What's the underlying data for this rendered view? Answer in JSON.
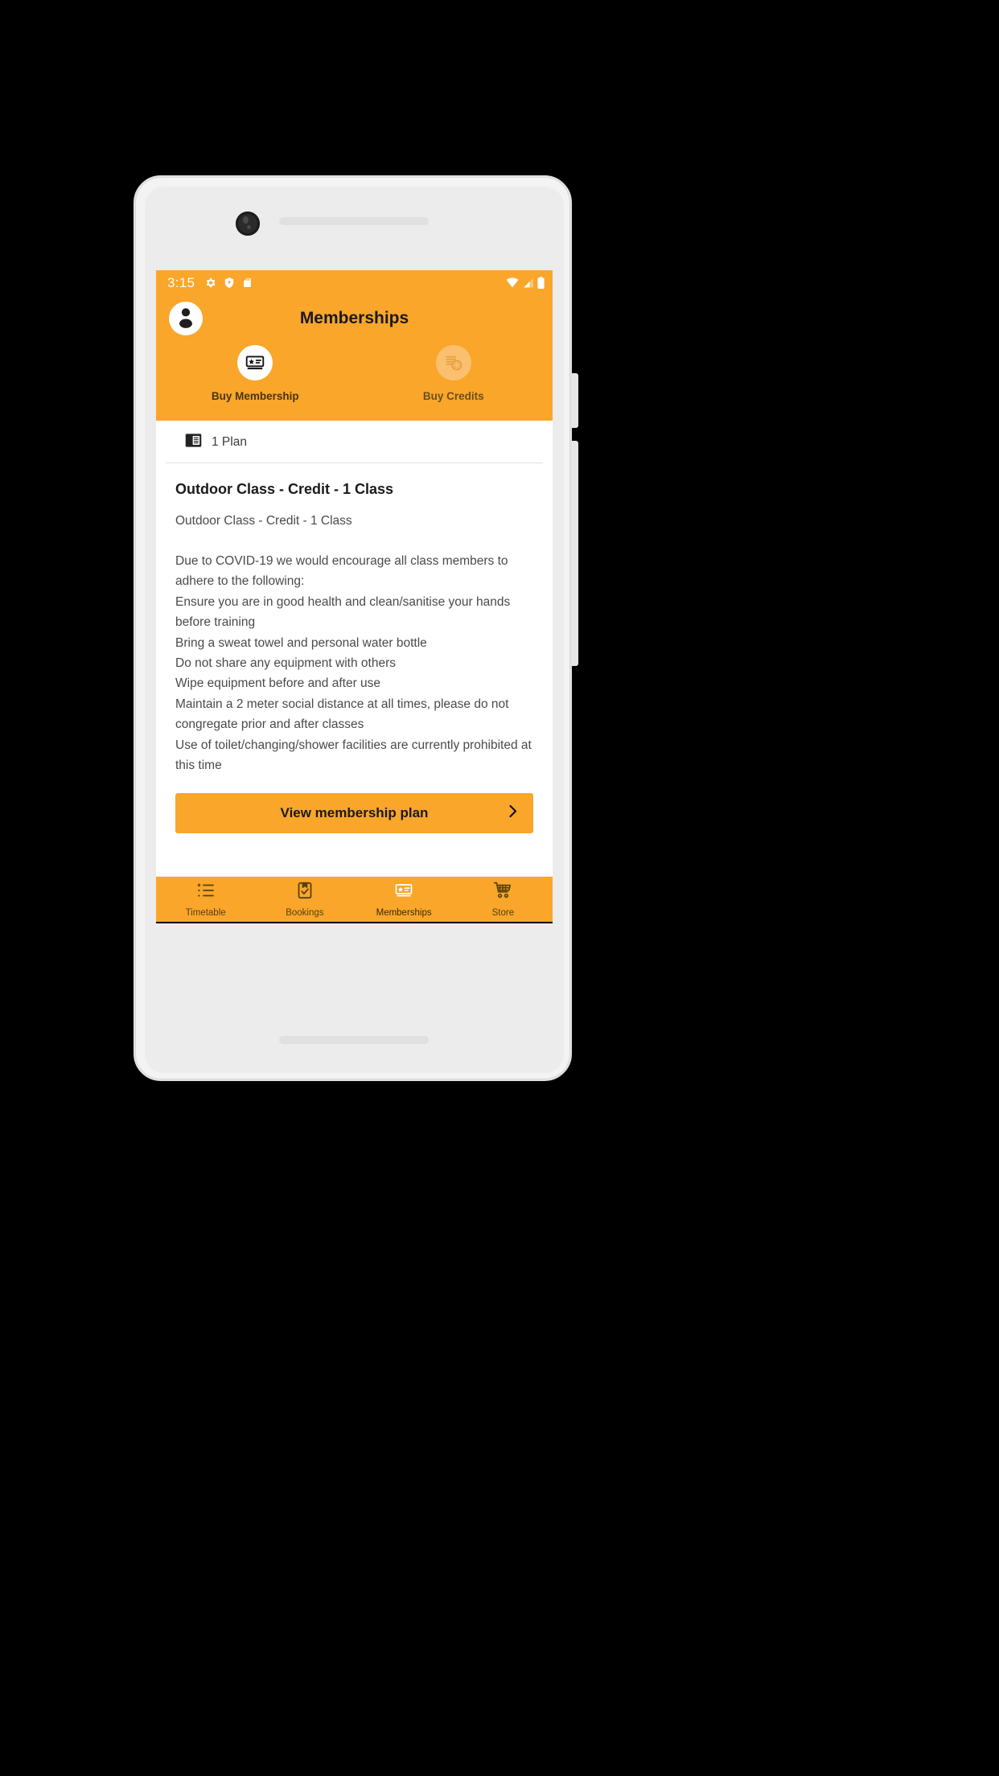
{
  "theme": {
    "accent": "#F9A62B",
    "accent_muted": "#FAC070",
    "text_dark": "#1A1A1A",
    "text_body": "#4A4A4A",
    "screen_bg": "#FFFFFF",
    "phone_body": "#F3F3F3"
  },
  "status_bar": {
    "time": "3:15",
    "left_icons": [
      "gear-icon",
      "shield-play-icon",
      "sd-card-icon"
    ],
    "right_icons": [
      "wifi-icon",
      "cellular-signal-icon",
      "battery-icon"
    ]
  },
  "app_bar": {
    "title": "Memberships",
    "avatar_icon": "account-circle-icon"
  },
  "tabs": [
    {
      "label": "Buy Membership",
      "icon": "membership-card-icon",
      "active": true
    },
    {
      "label": "Buy Credits",
      "icon": "credits-coin-icon",
      "active": false
    }
  ],
  "content": {
    "plan_count": "1 Plan",
    "plan_count_icon": "article-list-icon",
    "plan_title": "Outdoor Class - Credit - 1 Class",
    "plan_subtitle": "Outdoor Class - Credit - 1 Class",
    "plan_description": "Due to COVID-19 we would encourage all class members to adhere to the following:\nEnsure you are in good health and clean/sanitise your hands before training\nBring a sweat towel and personal water bottle\nDo not share any equipment with others\nWipe equipment before and after use\nMaintain a 2 meter social distance at all times, please do not congregate prior and after classes\nUse of toilet/changing/shower facilities are currently prohibited at this time",
    "view_plan_button": "View membership plan",
    "view_plan_chevron_icon": "chevron-right-icon"
  },
  "bottom_nav": [
    {
      "label": "Timetable",
      "icon": "list-star-icon",
      "active": false
    },
    {
      "label": "Bookings",
      "icon": "clipboard-check-icon",
      "active": false
    },
    {
      "label": "Memberships",
      "icon": "membership-card-icon",
      "active": true
    },
    {
      "label": "Store",
      "icon": "shopping-cart-icon",
      "active": false
    }
  ],
  "system_nav": {
    "back": "back-triangle-icon",
    "home": "home-circle-icon",
    "recents": "recents-square-icon"
  }
}
